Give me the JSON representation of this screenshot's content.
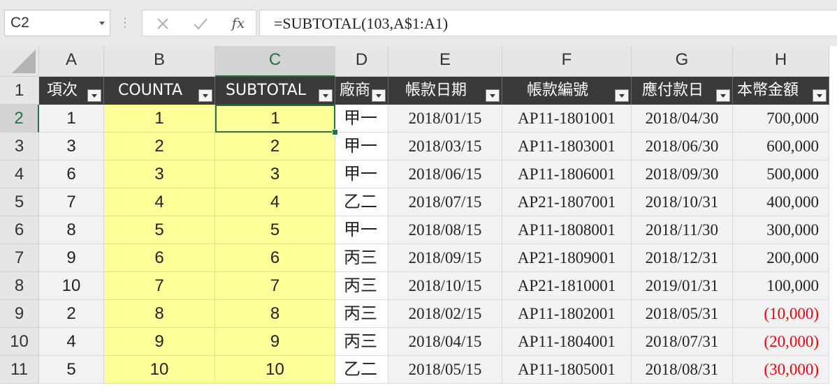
{
  "name_box": {
    "value": "C2"
  },
  "formula_bar": {
    "cancel_icon": "cancel-x",
    "enter_icon": "checkmark",
    "fx_label": "fx",
    "formula": "=SUBTOTAL(103,A$1:A1)"
  },
  "sheet": {
    "selected_column": "C",
    "selected_row": "2",
    "columns": [
      "A",
      "B",
      "C",
      "D",
      "E",
      "F",
      "G",
      "H"
    ],
    "row_numbers": [
      "1",
      "2",
      "3",
      "4",
      "5",
      "6",
      "7",
      "8",
      "9",
      "10",
      "11"
    ],
    "headers": [
      "項次",
      "COUNTA",
      "SUBTOTAL",
      "廠商",
      "帳款日期",
      "帳款編號",
      "應付款日",
      "本幣金額"
    ],
    "rows": [
      [
        "1",
        "1",
        "1",
        "甲一",
        "2018/01/15",
        "AP11-1801001",
        "2018/04/30",
        "700,000"
      ],
      [
        "3",
        "2",
        "2",
        "甲一",
        "2018/03/15",
        "AP11-1803001",
        "2018/06/30",
        "600,000"
      ],
      [
        "6",
        "3",
        "3",
        "甲一",
        "2018/06/15",
        "AP11-1806001",
        "2018/09/30",
        "500,000"
      ],
      [
        "7",
        "4",
        "4",
        "乙二",
        "2018/07/15",
        "AP21-1807001",
        "2018/10/31",
        "400,000"
      ],
      [
        "8",
        "5",
        "5",
        "甲一",
        "2018/08/15",
        "AP11-1808001",
        "2018/11/30",
        "300,000"
      ],
      [
        "9",
        "6",
        "6",
        "丙三",
        "2018/09/15",
        "AP21-1809001",
        "2018/12/31",
        "200,000"
      ],
      [
        "10",
        "7",
        "7",
        "丙三",
        "2018/10/15",
        "AP21-1810001",
        "2019/01/31",
        "100,000"
      ],
      [
        "2",
        "8",
        "8",
        "丙三",
        "2018/02/15",
        "AP11-1802001",
        "2018/05/31",
        "(10,000)"
      ],
      [
        "4",
        "9",
        "9",
        "丙三",
        "2018/04/15",
        "AP11-1804001",
        "2018/07/31",
        "(20,000)"
      ],
      [
        "5",
        "10",
        "10",
        "乙二",
        "2018/05/15",
        "AP11-1805001",
        "2018/08/31",
        "(30,000)"
      ]
    ],
    "colors": {
      "header_fill": "#3a3a3a",
      "highlight_fill": "#ffff99",
      "row_fill": "#f2f2f2",
      "negative_text": "#e8000b",
      "selection": "#217346"
    }
  }
}
